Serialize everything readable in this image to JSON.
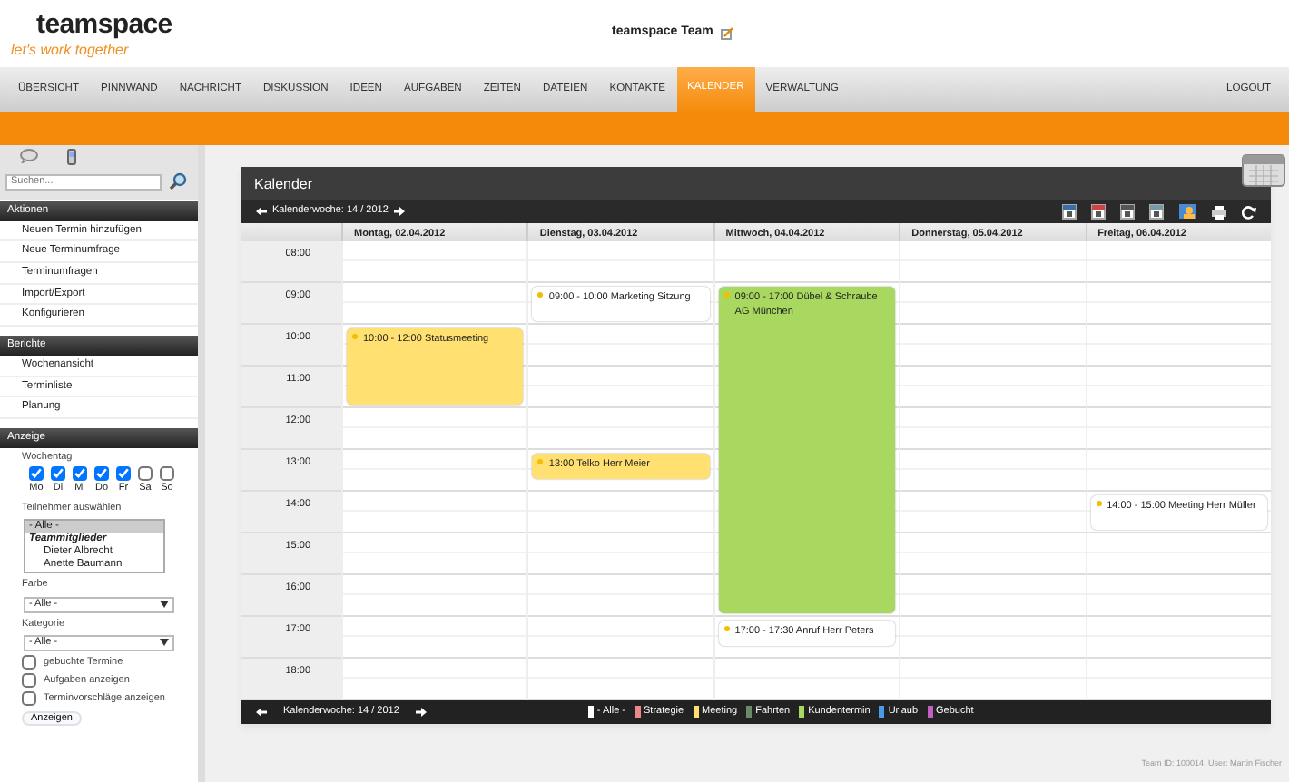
{
  "header": {
    "logo": "teamspace",
    "tagline": "let's work together",
    "team_name": "teamspace Team"
  },
  "nav": [
    {
      "label": "ÜBERSICHT",
      "selected": false
    },
    {
      "label": "PINNWAND",
      "selected": false
    },
    {
      "label": "NACHRICHT",
      "selected": false
    },
    {
      "label": "DISKUSSION",
      "selected": false
    },
    {
      "label": "IDEEN",
      "selected": false
    },
    {
      "label": "AUFGABEN",
      "selected": false
    },
    {
      "label": "ZEITEN",
      "selected": false
    },
    {
      "label": "DATEIEN",
      "selected": false
    },
    {
      "label": "KONTAKTE",
      "selected": false
    },
    {
      "label": "KALENDER",
      "selected": true
    },
    {
      "label": "VERWALTUNG",
      "selected": false
    }
  ],
  "logout": "LOGOUT",
  "sidebar": {
    "search": {
      "placeholder": "Suchen..."
    },
    "sections": [
      {
        "title": "Aktionen",
        "items": [
          "Neuen Termin hinzufügen",
          "Neue Terminumfrage",
          "Terminumfragen",
          "Import/Export",
          "Konfigurieren"
        ]
      },
      {
        "title": "Berichte",
        "items": [
          "Wochenansicht",
          "Terminliste",
          "Planung"
        ]
      }
    ],
    "display": {
      "title": "Anzeige",
      "weekday_label": "Wochentag",
      "weekdays": [
        {
          "label": "Mo",
          "checked": true
        },
        {
          "label": "Di",
          "checked": true
        },
        {
          "label": "Mi",
          "checked": true
        },
        {
          "label": "Do",
          "checked": true
        },
        {
          "label": "Fr",
          "checked": true
        },
        {
          "label": "Sa",
          "checked": false
        },
        {
          "label": "So",
          "checked": false
        }
      ],
      "participants_label": "Teilnehmer auswählen",
      "participants": [
        {
          "label": "- Alle -",
          "kind": "option",
          "selected": true
        },
        {
          "label": "Teammitglieder",
          "kind": "group",
          "selected": false
        },
        {
          "label": "Dieter Albrecht",
          "kind": "option",
          "selected": false
        },
        {
          "label": "Anette Baumann",
          "kind": "option",
          "selected": false
        }
      ],
      "color_label": "Farbe",
      "color_value": "- Alle -",
      "category_label": "Kategorie",
      "category_value": "- Alle -",
      "options": [
        {
          "label": "gebuchte Termine",
          "checked": false
        },
        {
          "label": "Aufgaben anzeigen",
          "checked": false
        },
        {
          "label": "Terminvorschläge anzeigen",
          "checked": false
        }
      ],
      "button": "Anzeigen"
    }
  },
  "calendar": {
    "title": "Kalender",
    "week": "Kalenderwoche: 14 / 2012",
    "hours": [
      "08:00",
      "09:00",
      "10:00",
      "11:00",
      "12:00",
      "13:00",
      "14:00",
      "15:00",
      "16:00",
      "17:00",
      "18:00"
    ],
    "days": [
      {
        "label": "Montag, 02.04.2012",
        "events": [
          {
            "text": "10:00 - 12:00 Statusmeeting",
            "color": "#ffe070"
          }
        ]
      },
      {
        "label": "Dienstag, 03.04.2012",
        "events": [
          {
            "text": "09:00 - 10:00 Marketing Sitzung",
            "color": "#ffffff"
          },
          {
            "text": "13:00 Telko Herr Meier",
            "color": "#ffe070"
          }
        ]
      },
      {
        "label": "Mittwoch, 04.04.2012",
        "events": [
          {
            "text": "09:00 - 17:00 Dübel & Schraube AG München",
            "color": "#a8d860"
          },
          {
            "text": "17:00 - 17:30 Anruf Herr Peters",
            "color": "#ffffff"
          }
        ]
      },
      {
        "label": "Donnerstag, 05.04.2012"
      },
      {
        "label": "Freitag, 06.04.2012",
        "events": [
          {
            "text": "14:00 - 15:00 Meeting Herr Müller",
            "color": "#ffffff"
          }
        ]
      }
    ],
    "footer_week": "Kalenderwoche: 14 / 2012",
    "legend": [
      {
        "label": "- Alle -",
        "color": "#ffffff"
      },
      {
        "label": "Strategie",
        "color": "#e88a8a"
      },
      {
        "label": "Meeting",
        "color": "#ffe070"
      },
      {
        "label": "Fahrten",
        "color": "#6a8a6a"
      },
      {
        "label": "Kundentermin",
        "color": "#a8d860"
      },
      {
        "label": "Urlaub",
        "color": "#4a9ae8"
      },
      {
        "label": "Gebucht",
        "color": "#c060c0"
      }
    ]
  },
  "status": "Team ID: 100014, User: Martin Fischer"
}
